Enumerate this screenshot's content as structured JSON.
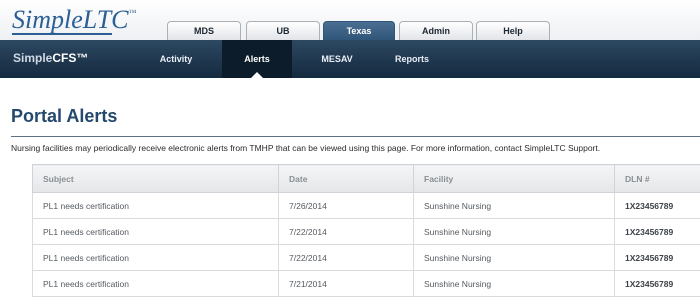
{
  "logo": {
    "simple": "Simple",
    "ltc": "LTC",
    "tm": "™"
  },
  "tabs": [
    {
      "label": "MDS",
      "active": false
    },
    {
      "label": "UB",
      "active": false
    },
    {
      "label": "Texas",
      "active": true
    },
    {
      "label": "Admin",
      "active": false
    },
    {
      "label": "Help",
      "active": false
    }
  ],
  "product": {
    "simple": "Simple",
    "name": "CFS™"
  },
  "subnav": [
    {
      "label": "Activity",
      "active": false
    },
    {
      "label": "Alerts",
      "active": true
    },
    {
      "label": "MESAV",
      "active": false
    },
    {
      "label": "Reports",
      "active": false
    }
  ],
  "page": {
    "title": "Portal Alerts",
    "intro": "Nursing facilities may periodically receive electronic alerts from TMHP that can be viewed using this page. For more information, contact SimpleLTC Support."
  },
  "table": {
    "columns": [
      "Subject",
      "Date",
      "Facility",
      "DLN #"
    ],
    "rows": [
      [
        "PL1 needs certification",
        "7/26/2014",
        "Sunshine Nursing",
        "1X23456789"
      ],
      [
        "PL1 needs certification",
        "7/22/2014",
        "Sunshine Nursing",
        "1X23456789"
      ],
      [
        "PL1 needs certification",
        "7/22/2014",
        "Sunshine Nursing",
        "1X23456789"
      ],
      [
        "PL1 needs certification",
        "7/21/2014",
        "Sunshine Nursing",
        "1X23456789"
      ]
    ]
  },
  "colors": {
    "brand": "#2c5f96",
    "nav_dark": "#142a3f",
    "title": "#24486e",
    "active_tab": "#2f5579"
  }
}
